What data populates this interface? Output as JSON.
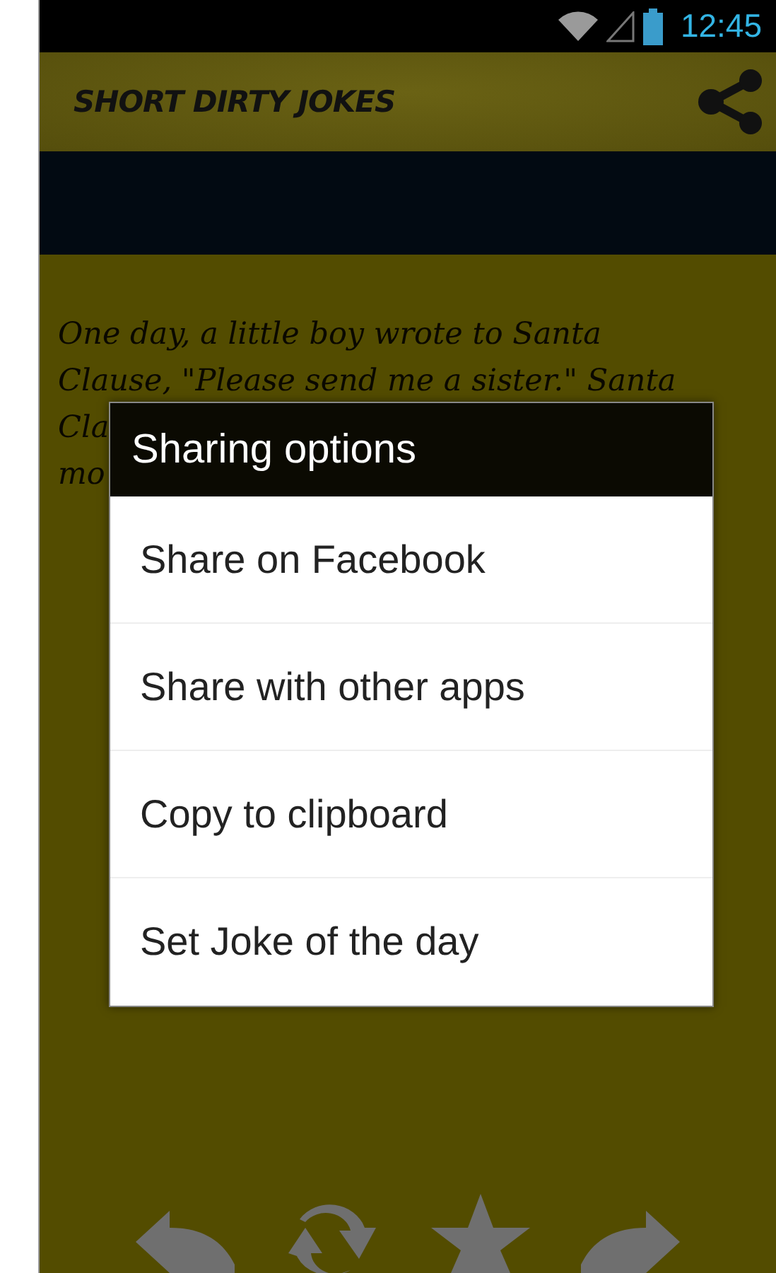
{
  "status_bar": {
    "time": "12:45"
  },
  "app_bar": {
    "title": "SHORT DIRTY JOKES"
  },
  "joke": {
    "lines": [
      "One day, a little boy wrote to Santa",
      "Clause, \"Please send me a sister.\" Santa",
      "Cla",
      "mo"
    ]
  },
  "dialog": {
    "title": "Sharing options",
    "options": [
      "Share on Facebook",
      "Share with other apps",
      "Copy to clipboard",
      "Set Joke of the day"
    ]
  }
}
